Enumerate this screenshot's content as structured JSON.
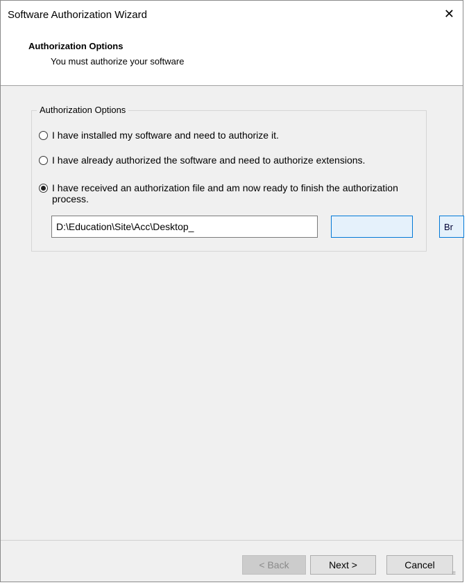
{
  "window": {
    "title": "Software Authorization Wizard"
  },
  "header": {
    "title": "Authorization Options",
    "subtitle": "You must authorize your software"
  },
  "group": {
    "legend": "Authorization Options",
    "options": [
      {
        "label": "I have installed my software and need to authorize it.",
        "selected": false
      },
      {
        "label": "I have already authorized the software and need to authorize extensions.",
        "selected": false
      },
      {
        "label": "I have received an authorization file and am now ready to finish the authorization process.",
        "selected": true
      }
    ]
  },
  "file": {
    "path": "D:\\Education\\Site\\Acc\\Desktop_"
  },
  "buttons": {
    "back": "< Back",
    "next": "Next >",
    "cancel": "Cancel",
    "browse_partial": "Br"
  }
}
